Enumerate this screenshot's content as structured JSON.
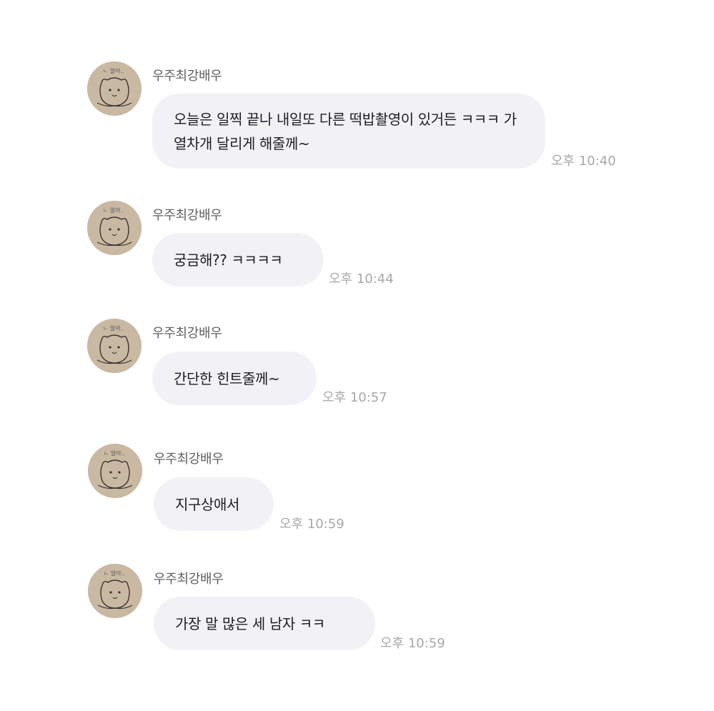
{
  "messages": [
    {
      "sender": "우주최강배우",
      "text": "오늘은 일찍 끝나 내일또 다른 떡밥촬영이 있거든 ㅋㅋㅋ 가열차개 달리게 해줄께~",
      "time": "오후 10:40"
    },
    {
      "sender": "우주최강배우",
      "text": "궁금해?? ㅋㅋㅋㅋ",
      "time": "오후 10:44"
    },
    {
      "sender": "우주최강배우",
      "text": "간단한 힌트줄께~",
      "time": "오후 10:57"
    },
    {
      "sender": "우주최강배우",
      "text": "지구상애서",
      "time": "오후 10:59"
    },
    {
      "sender": "우주최강배우",
      "text": "가장 말 많은 세 남자 ㅋㅋ",
      "time": "오후 10:59"
    }
  ],
  "avatar_icon": "bear-drawing-avatar",
  "colors": {
    "bubble": "#f2f2f6",
    "text": "#1e1e1e",
    "sender": "#5f5f5f",
    "time": "#a8a8ac"
  }
}
